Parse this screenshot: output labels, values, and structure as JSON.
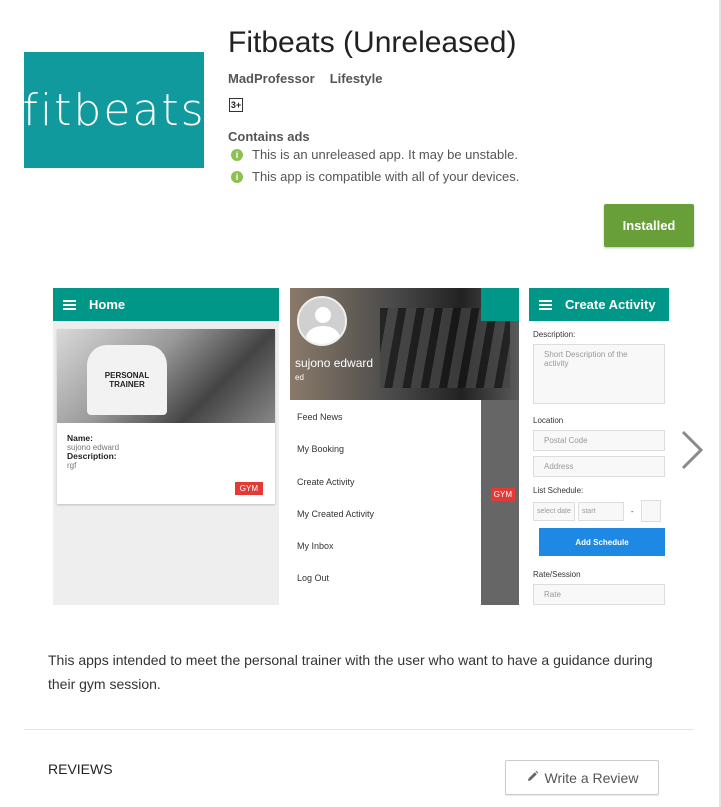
{
  "app": {
    "title": "Fitbeats (Unreleased)",
    "logo_text": "fitbeats",
    "developer": "MadProfessor",
    "category": "Lifestyle",
    "content_rating": "3+",
    "contains_ads": "Contains ads",
    "notes": [
      "This is an unreleased app. It may be unstable.",
      "This app is compatible with all of your devices."
    ],
    "install_button": "Installed",
    "brand_color": "#119a9e",
    "install_color": "#689f38"
  },
  "screenshots": {
    "shot1": {
      "appbar_title": "Home",
      "shirt_text": "PERSONAL TRAINER",
      "name_label": "Name:",
      "name_value": "sujono edward",
      "desc_label": "Description:",
      "desc_value": "rgf",
      "badge": "GYM"
    },
    "shot2": {
      "user_name": "sujono edward",
      "user_sub": "ed",
      "menu": [
        "Feed News",
        "My Booking",
        "Create Activity",
        "My Created Activity",
        "My Inbox",
        "Log Out"
      ],
      "badge": "GYM"
    },
    "shot3": {
      "appbar_title": "Create Activity",
      "description_label": "Description:",
      "description_placeholder": "Short Description of the activity",
      "location_label": "Location",
      "postal_placeholder": "Postal Code",
      "address_placeholder": "Address",
      "schedule_label": "List Schedule:",
      "date_placeholder": "select date",
      "start_placeholder": "start",
      "dash": "-",
      "add_button": "Add Schedule",
      "rate_label": "Rate/Session",
      "rate_placeholder": "Rate"
    }
  },
  "description": "This apps intended to meet the personal trainer with the user who want to have a guidance during their gym session.",
  "reviews": {
    "heading": "REVIEWS",
    "write_button": "Write a Review"
  }
}
